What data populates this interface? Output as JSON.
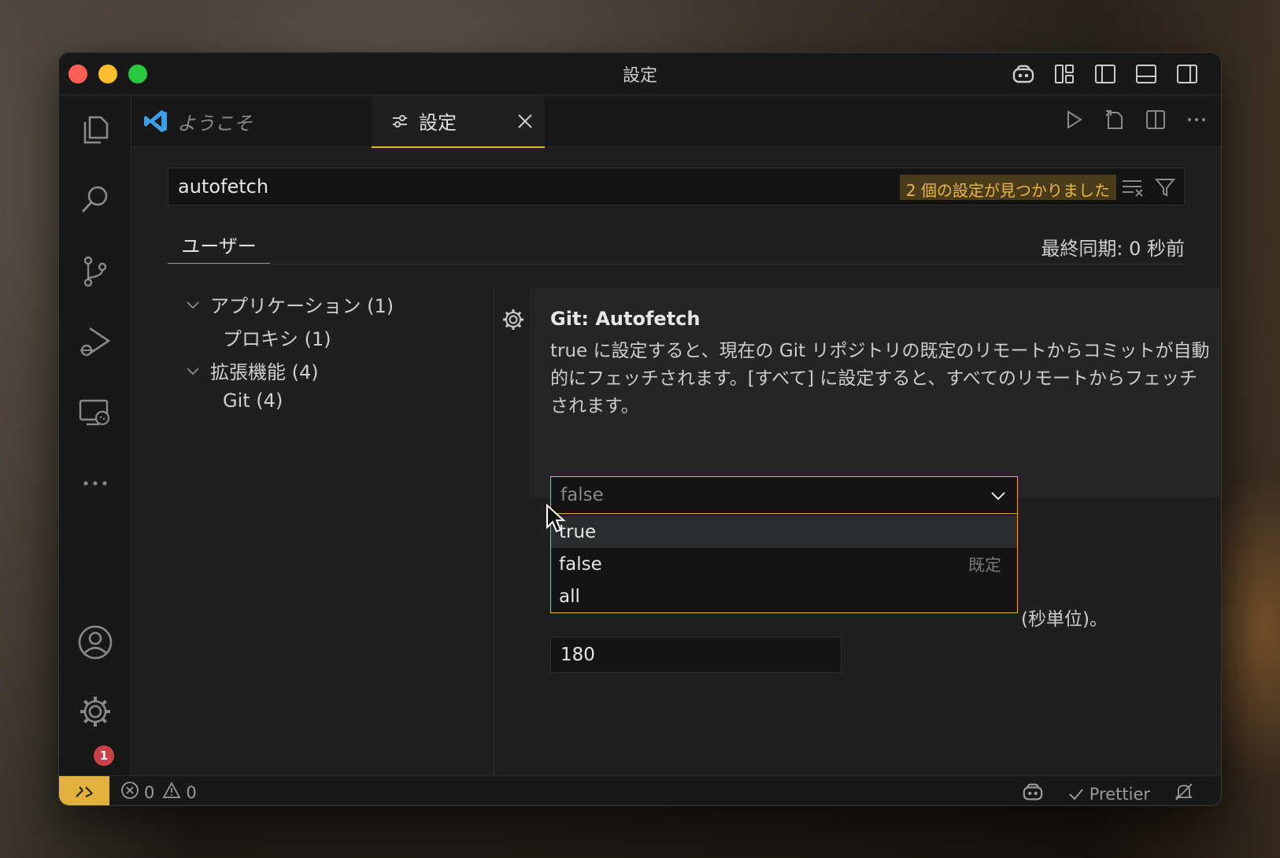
{
  "window": {
    "title": "設定"
  },
  "tabs": [
    {
      "label": "ようこそ"
    },
    {
      "label": "設定"
    }
  ],
  "search": {
    "value": "autofetch",
    "result_badge": "2 個の設定が見つかりました"
  },
  "scope": {
    "tab_label": "ユーザー",
    "sync_status": "最終同期: 0 秒前"
  },
  "toc": {
    "items": [
      {
        "label": "アプリケーション (1)"
      },
      {
        "label": "プロキシ (1)"
      },
      {
        "label": "拡張機能 (4)"
      },
      {
        "label": "Git (4)"
      }
    ]
  },
  "setting": {
    "title": "Git: Autofetch",
    "description": "true に設定すると、現在の Git リポジトリの既定のリモートからコミットが自動的にフェッチされます。[すべて] に設定すると、すべてのリモートからフェッチされます。",
    "selected_value": "false",
    "options": [
      {
        "label": "true",
        "hint": ""
      },
      {
        "label": "false",
        "hint": "既定"
      },
      {
        "label": "all",
        "hint": ""
      }
    ]
  },
  "setting2": {
    "description_tail": "(秒単位)。",
    "value": "180"
  },
  "activity_bar": {
    "manage_badge": "1"
  },
  "statusbar": {
    "errors": "0",
    "warnings": "0",
    "prettier": "Prettier"
  },
  "colors": {
    "accent": "#e2b13c",
    "badge": "#c9424a"
  }
}
